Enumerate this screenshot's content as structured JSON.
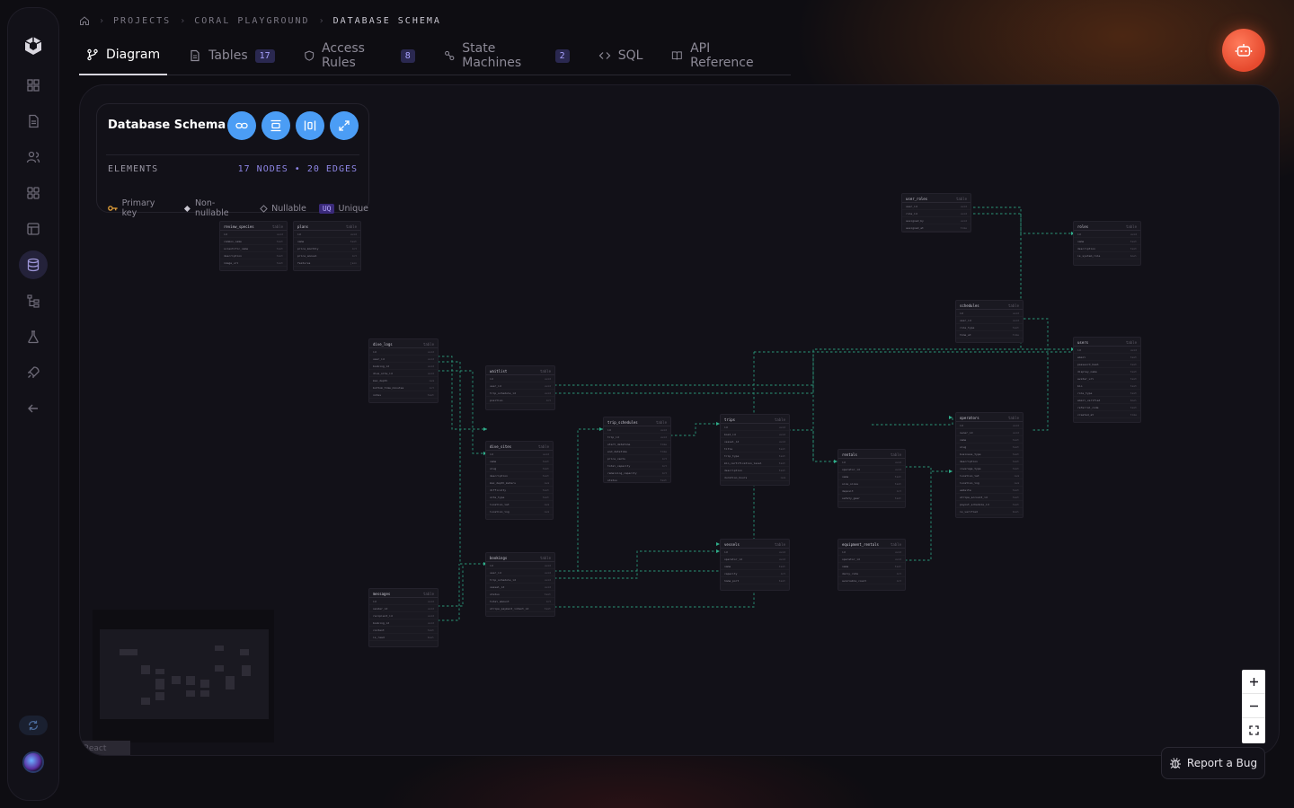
{
  "breadcrumb": {
    "items": [
      "PROJECTS",
      "CORAL PLAYGROUND",
      "DATABASE SCHEMA"
    ]
  },
  "tabs": [
    {
      "label": "Diagram",
      "icon": "branch-icon",
      "active": true
    },
    {
      "label": "Tables",
      "icon": "file-icon",
      "badge": "17"
    },
    {
      "label": "Access Rules",
      "icon": "shield-icon",
      "badge": "8"
    },
    {
      "label": "State Machines",
      "icon": "state-machine-icon",
      "badge": "2"
    },
    {
      "label": "SQL",
      "icon": "code-icon"
    },
    {
      "label": "API Reference",
      "icon": "book-icon"
    }
  ],
  "info_panel": {
    "title": "Database Schema",
    "elements_label": "ELEMENTS",
    "elements_count": "17 NODES • 20 EDGES",
    "legend": {
      "primary_key": "Primary key",
      "non_nullable": "Non-nullable",
      "nullable": "Nullable",
      "unique_tag": "UQ",
      "unique": "Unique"
    }
  },
  "canvas": {
    "attribution": "React Flow"
  },
  "report_bug": {
    "label": "Report a Bug"
  },
  "colors": {
    "accent_blue": "#4b9df5",
    "accent_purple": "#8e86e6",
    "edge_green": "#2fae8a",
    "bot_orange": "#e64a2e"
  },
  "nodes": [
    {
      "name": "review_species",
      "cols": [
        "id",
        "common_name",
        "scientific_name",
        "description",
        "image_url",
        "created_at"
      ]
    },
    {
      "name": "plans",
      "cols": [
        "id",
        "name",
        "price_monthly",
        "price_annual",
        "features",
        "is_active"
      ]
    },
    {
      "name": "user_roles",
      "cols": [
        "user_id",
        "role_id",
        "assigned_by",
        "assigned_at"
      ]
    },
    {
      "name": "roles",
      "cols": [
        "id",
        "name",
        "description",
        "is_system_role",
        "created_at"
      ]
    },
    {
      "name": "dive_logs",
      "cols": [
        "id",
        "user_id",
        "booking_id",
        "dive_site_id",
        "max_depth",
        "bottom_time_minutes",
        "notes",
        "logged_at"
      ]
    },
    {
      "name": "waitlist",
      "cols": [
        "id",
        "user_id",
        "trip_schedule_id",
        "position",
        "created_at"
      ]
    },
    {
      "name": "dive_sites",
      "cols": [
        "id",
        "name",
        "slug",
        "description",
        "max_depth_meters",
        "difficulty",
        "site_type",
        "location_lat",
        "location_lng",
        "created_at"
      ]
    },
    {
      "name": "trip_schedules",
      "cols": [
        "id",
        "trip_id",
        "start_datetime",
        "end_datetime",
        "price_cents",
        "total_capacity",
        "remaining_capacity",
        "status"
      ]
    },
    {
      "name": "trips",
      "cols": [
        "id",
        "boat_id",
        "vessel_id",
        "title",
        "trip_type",
        "min_certification_level",
        "description",
        "duration_hours",
        "created_at"
      ]
    },
    {
      "name": "vessels",
      "cols": [
        "id",
        "operator_id",
        "name",
        "capacity",
        "home_port",
        "created_at"
      ]
    },
    {
      "name": "schedules",
      "cols": [
        "id",
        "user_id",
        "role_type",
        "time_at",
        "created_at"
      ]
    },
    {
      "name": "users",
      "cols": [
        "id",
        "email",
        "password_hash",
        "display_name",
        "avatar_url",
        "bio",
        "role_type",
        "email_verified",
        "referral_code",
        "created_at",
        "updated_at"
      ]
    },
    {
      "name": "operators",
      "cols": [
        "id",
        "owner_id",
        "name",
        "slug",
        "business_type",
        "description",
        "coverage_type",
        "location_lat",
        "location_lng",
        "website",
        "stripe_account_id",
        "payout_schedule_id",
        "is_verified",
        "created_at",
        "updated_at"
      ]
    },
    {
      "name": "rentals",
      "cols": [
        "id",
        "operator_id",
        "name",
        "size_sizes",
        "deposit",
        "safety_gear",
        "created_at"
      ]
    },
    {
      "name": "bookings",
      "cols": [
        "id",
        "user_id",
        "trip_schedule_id",
        "vessel_id",
        "status",
        "total_amount",
        "stripe_payment_intent_id",
        "created_at"
      ]
    },
    {
      "name": "equipment_rentals",
      "cols": [
        "id",
        "operator_id",
        "name",
        "daily_rate",
        "available_count",
        "is_active"
      ]
    },
    {
      "name": "messages",
      "cols": [
        "id",
        "sender_id",
        "recipient_id",
        "booking_id",
        "content",
        "is_read",
        "created_at"
      ]
    }
  ]
}
